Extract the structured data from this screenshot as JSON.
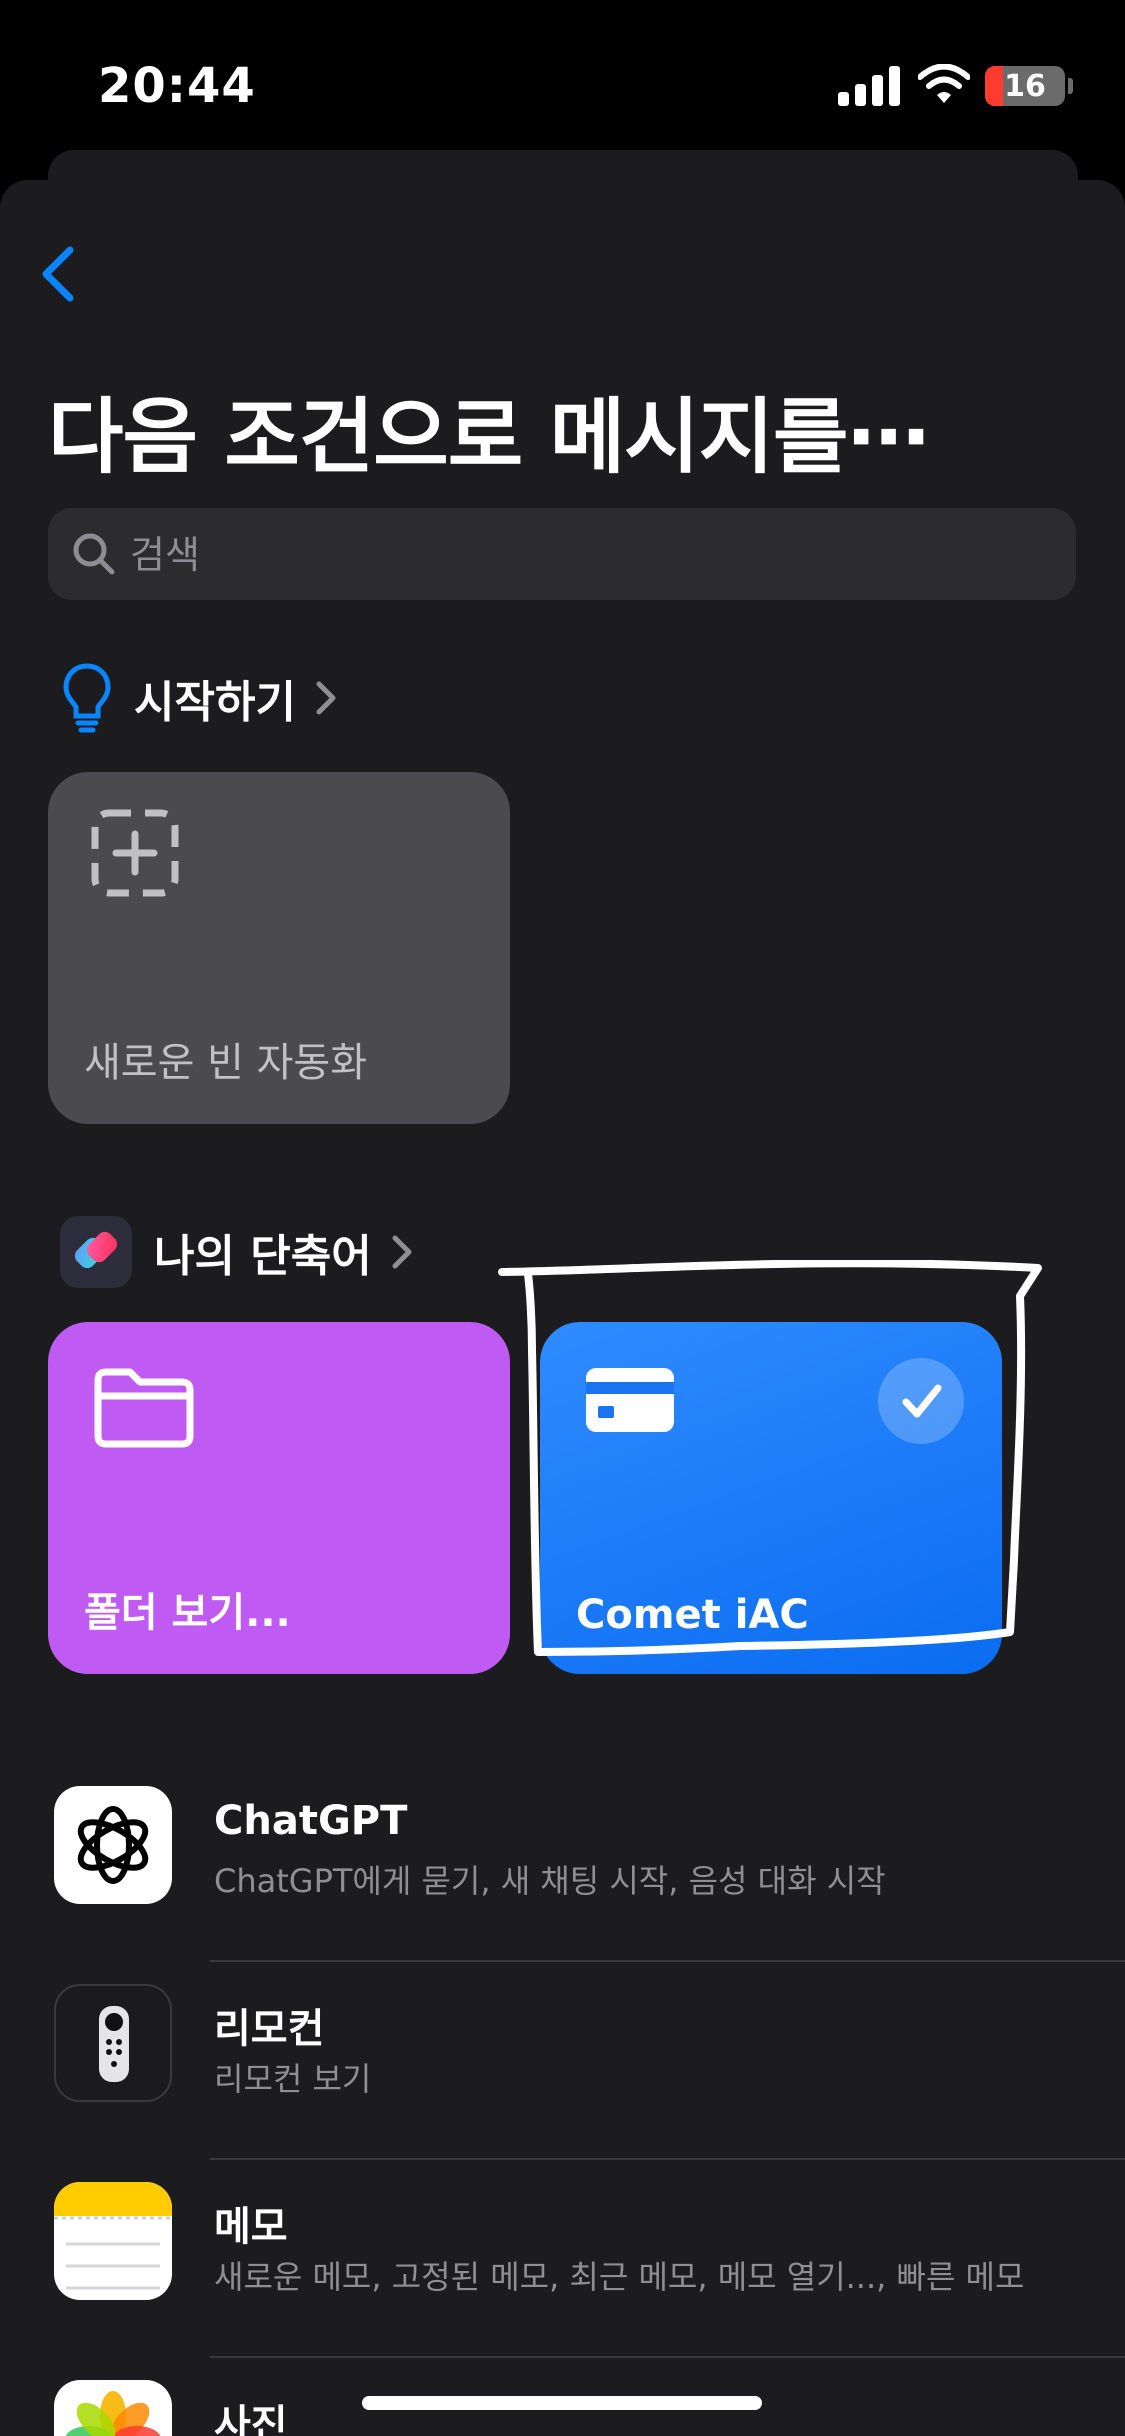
{
  "status": {
    "time": "20:44",
    "battery": "16"
  },
  "header": {
    "title": "다음 조건으로 메시지를⋯"
  },
  "search": {
    "placeholder": "검색"
  },
  "getting_started": {
    "label": "시작하기",
    "tiles": [
      {
        "label": "새로운 빈 자동화"
      }
    ]
  },
  "my_shortcuts": {
    "label": "나의 단축어",
    "tiles": [
      {
        "label": "폴더 보기...",
        "color": "#bf5af2",
        "icon": "folder-icon"
      },
      {
        "label": "Comet iAC",
        "color": "#1c7df5",
        "icon": "credit-card-icon",
        "selected": true
      }
    ]
  },
  "apps": [
    {
      "name": "ChatGPT",
      "desc": "ChatGPT에게 묻기, 새 채팅 시작, 음성 대화 시작",
      "icon": "chatgpt-icon"
    },
    {
      "name": "리모컨",
      "desc": "리모컨 보기",
      "icon": "remote-icon"
    },
    {
      "name": "메모",
      "desc": "새로운 메모, 고정된 메모, 최근 메모, 메모 열기..., 빠른 메모",
      "icon": "notes-icon"
    },
    {
      "name": "사진",
      "desc": "",
      "icon": "photos-icon"
    }
  ],
  "colors": {
    "accent": "#0a84ff",
    "background": "#1c1c1e",
    "purple": "#bf5af2",
    "blue": "#1c7df5"
  }
}
